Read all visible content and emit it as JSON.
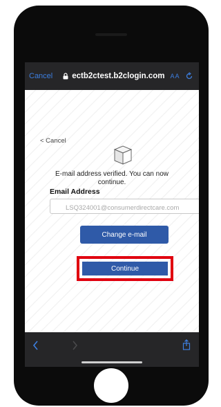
{
  "browser": {
    "cancel_label": "Cancel",
    "url": "ectb2ctest.b2clogin.com",
    "text_size_label": "AA"
  },
  "page": {
    "back_label": "< Cancel",
    "verified_message": "E-mail address verified. You can now continue.",
    "email_label": "Email Address",
    "email_value": "LSQ324001@consumerdirectcare.com",
    "change_email_label": "Change e-mail",
    "continue_label": "Continue"
  },
  "colors": {
    "button_blue": "#2f5aa8",
    "highlight_red": "#e0000f",
    "ios_link_blue": "#3d7fe0"
  },
  "icons": {
    "lock": "lock-icon",
    "reload": "reload-icon",
    "back": "back-arrow-icon",
    "forward": "forward-arrow-icon",
    "share": "share-icon",
    "logo": "cube-logo-icon"
  }
}
